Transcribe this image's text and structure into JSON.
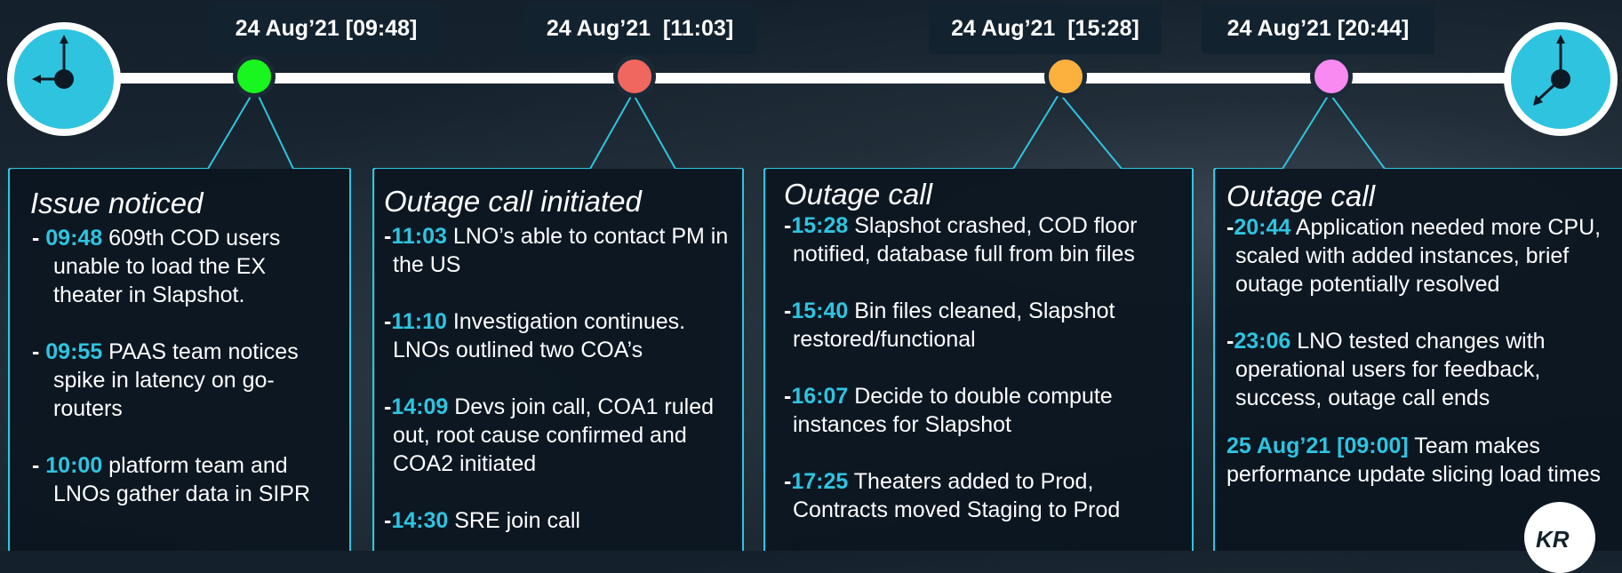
{
  "timeline": {
    "dates": [
      "24 Aug’21 [09:48]",
      "24 Aug’21  [11:03]",
      "24 Aug’21  [15:28]",
      "24 Aug’21 [20:44]"
    ],
    "dot_colors": [
      "#19f51e",
      "#f0675f",
      "#fcb13f",
      "#f98af2"
    ],
    "accent_color": "#2ec4e0",
    "icons": [
      "clock-icon",
      "clock-icon"
    ]
  },
  "cards": [
    {
      "title": "Issue noticed",
      "entries": [
        {
          "time": "09:48",
          "text": " 609th COD users unable to load the EX theater in Slapshot."
        },
        {
          "time": "09:55",
          "text": " PAAS team notices spike in latency on go-routers"
        },
        {
          "time": "10:00",
          "text": " platform team and LNOs gather data in SIPR"
        }
      ]
    },
    {
      "title": "Outage call initiated",
      "entries": [
        {
          "time": "11:03",
          "text": " LNO’s able to contact PM in the US"
        },
        {
          "time": "11:10",
          "text": " Investigation continues. LNOs outlined two COA’s"
        },
        {
          "time": "14:09",
          "text": " Devs join call, COA1 ruled out, root cause confirmed and COA2 initiated"
        },
        {
          "time": "14:30",
          "text": " SRE join call"
        }
      ]
    },
    {
      "title": "Outage call",
      "entries": [
        {
          "time": "15:28",
          "text": " Slapshot crashed, COD floor notified, database full from bin files"
        },
        {
          "time": "15:40",
          "text": " Bin files cleaned, Slapshot restored/functional"
        },
        {
          "time": "16:07",
          "text": " Decide to double compute instances for Slapshot"
        },
        {
          "time": "17:25",
          "text": " Theaters added to Prod, Contracts moved Staging to Prod"
        }
      ]
    },
    {
      "title": "Outage call",
      "entries": [
        {
          "time": "20:44",
          "text": " Application needed more CPU,  scaled with added instances, brief outage potentially resolved"
        },
        {
          "time": "23:06",
          "text": " LNO tested changes with operational users for feedback, success, outage call ends"
        }
      ],
      "footer": {
        "time": "25 Aug’21 [09:00]",
        "text": " Team makes performance update slicing load times"
      }
    }
  ],
  "logo": {
    "text": "KR"
  }
}
